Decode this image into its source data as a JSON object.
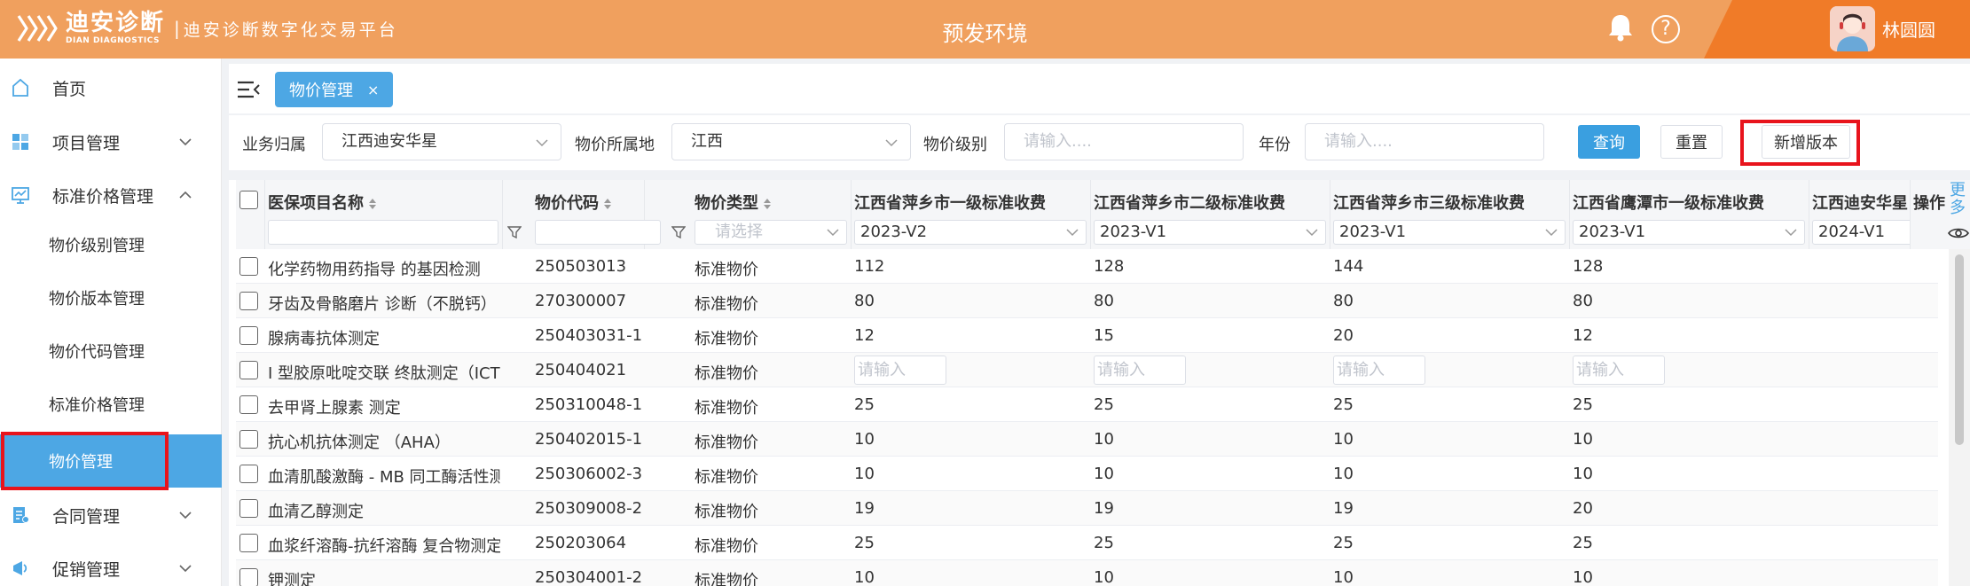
{
  "header": {
    "logo_cn": "迪安诊断",
    "logo_en": "DIAN DIAGNOSTICS",
    "separator": "|",
    "platform_name": "迪安诊断数字化交易平台",
    "env_title": "预发环境",
    "help_glyph": "?",
    "username": "林圆圆",
    "brand_color": "#f0a05e",
    "accent_color": "#f07b28"
  },
  "sidebar": {
    "home": "首页",
    "project_mgmt": "项目管理",
    "standard_price_mgmt": "标准价格管理",
    "sub_items": [
      "物价级别管理",
      "物价版本管理",
      "物价代码管理",
      "标准价格管理",
      "物价管理"
    ],
    "contract_mgmt": "合同管理",
    "promo_mgmt": "促销管理",
    "active_color": "#4da7e4"
  },
  "tabs": {
    "active": "物价管理",
    "close": "×"
  },
  "filters": {
    "business_label": "业务归属",
    "business_value": "江西迪安华星",
    "region_label": "物价所属地",
    "region_value": "江西",
    "level_label": "物价级别",
    "level_placeholder": "请输入....",
    "year_label": "年份",
    "year_placeholder": "请输入....",
    "query_button": "查询",
    "reset_button": "重置",
    "add_version_button": "新增版本"
  },
  "table": {
    "columns": {
      "name": "医保项目名称",
      "code": "物价代码",
      "type": "物价类型",
      "c1": "江西省萍乡市一级标准收费",
      "c2": "江西省萍乡市二级标准收费",
      "c3": "江西省萍乡市三级标准收费",
      "c4": "江西省鹰潭市一级标准收费",
      "c5": "江西迪安华星自",
      "ops": "操作"
    },
    "filters": {
      "type_placeholder": "请选择",
      "v1": "2023-V2",
      "v2": "2023-V1",
      "v3": "2023-V1",
      "v4": "2023-V1",
      "v5": "2024-V1"
    },
    "more_label": "更多",
    "input_placeholder": "请输入",
    "rows": [
      {
        "name": "化学药物用药指导 的基因检测",
        "code": "250503013",
        "type": "标准物价",
        "p1": "112",
        "p2": "128",
        "p3": "144",
        "p4": "128"
      },
      {
        "name": "牙齿及骨骼磨片 诊断（不脱钙）",
        "code": "270300007",
        "type": "标准物价",
        "p1": "80",
        "p2": "80",
        "p3": "80",
        "p4": "80"
      },
      {
        "name": "腺病毒抗体测定",
        "code": "250403031-1",
        "type": "标准物价",
        "p1": "12",
        "p2": "15",
        "p3": "20",
        "p4": "12"
      },
      {
        "name": "I 型胶原吡啶交联 终肽测定（ICTP）",
        "code": "250404021",
        "type": "标准物价",
        "p1": "",
        "p2": "",
        "p3": "",
        "p4": ""
      },
      {
        "name": "去甲肾上腺素 测定",
        "code": "250310048-1",
        "type": "标准物价",
        "p1": "25",
        "p2": "25",
        "p3": "25",
        "p4": "25"
      },
      {
        "name": "抗心机抗体测定 （AHA）",
        "code": "250402015-1",
        "type": "标准物价",
        "p1": "10",
        "p2": "10",
        "p3": "10",
        "p4": "10"
      },
      {
        "name": "血清肌酸激酶 - MB 同工酶活性测定",
        "code": "250306002-3",
        "type": "标准物价",
        "p1": "10",
        "p2": "10",
        "p3": "10",
        "p4": "10"
      },
      {
        "name": "血清乙醇测定",
        "code": "250309008-2",
        "type": "标准物价",
        "p1": "19",
        "p2": "19",
        "p3": "19",
        "p4": "20"
      },
      {
        "name": "血浆纤溶酶-抗纤溶酶 复合物测定(...",
        "code": "250203064",
        "type": "标准物价",
        "p1": "25",
        "p2": "25",
        "p3": "25",
        "p4": "25"
      },
      {
        "name": "钾测定",
        "code": "250304001-2",
        "type": "标准物价",
        "p1": "10",
        "p2": "10",
        "p3": "10",
        "p4": "10"
      }
    ]
  }
}
